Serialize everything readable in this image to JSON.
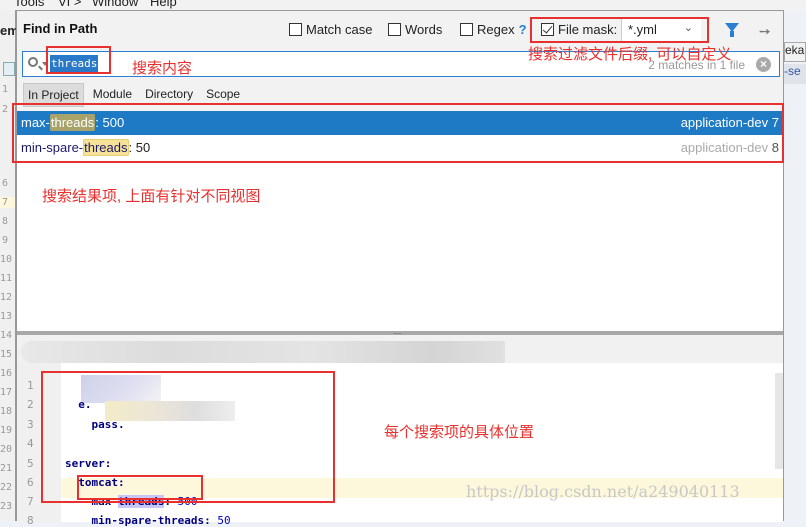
{
  "background": {
    "menu": [
      "Tools",
      "VI >",
      "Window",
      "Help"
    ],
    "left_truncated_label": "em",
    "right_tab_1": "eka",
    "right_tab_2": "-se",
    "gutter_lines": [
      "1",
      "2",
      "6",
      "7",
      "8",
      "9",
      "10",
      "11",
      "12",
      "13",
      "14",
      "15",
      "16",
      "17",
      "18",
      "19",
      "20",
      "21",
      "22",
      "23"
    ]
  },
  "dialog": {
    "title": "Find in Path",
    "options": {
      "match_case": {
        "label": "Match case",
        "checked": false
      },
      "words": {
        "label": "Words",
        "checked": false
      },
      "regex": {
        "label": "Regex",
        "checked": false,
        "help": "?"
      },
      "file_mask": {
        "label": "File mask:",
        "checked": true,
        "value": "*.yml"
      }
    },
    "search": {
      "value": "threads",
      "match_count": "2 matches in 1 file"
    },
    "scope_tabs": [
      {
        "label": "In Project",
        "active": true
      },
      {
        "label": "Module",
        "active": false
      },
      {
        "label": "Directory",
        "active": false
      },
      {
        "label": "Scope",
        "active": false
      }
    ],
    "results": [
      {
        "prefix": "max-",
        "match": "threads",
        "suffix": ": 500",
        "file": "application-dev",
        "line": "7",
        "selected": true
      },
      {
        "prefix": "min-spare-",
        "match": "threads",
        "suffix": ": 50",
        "file": "application-dev",
        "line": "8",
        "selected": false
      }
    ],
    "preview": {
      "lines": [
        {
          "num": "1",
          "text": ""
        },
        {
          "num": "2",
          "text": "  e."
        },
        {
          "num": "3",
          "text": "    pass."
        },
        {
          "num": "4",
          "text": ""
        },
        {
          "num": "5",
          "text": "server:"
        },
        {
          "num": "6",
          "text": "  tomcat:"
        },
        {
          "num": "7",
          "pre": "    max-",
          "match": "threads",
          "post": ": ",
          "value": "500"
        },
        {
          "num": "8",
          "pre": "    min-spare-threads: ",
          "value": "50"
        }
      ]
    }
  },
  "annotations": {
    "search_content": "搜索内容",
    "file_mask_note": "搜索过滤文件后缀, 可以自定义",
    "results_note": "搜索结果项, 上面有针对不同视图",
    "preview_note": "每个搜索项的具体位置"
  },
  "watermark": "https://blog.csdn.net/a249040113",
  "colors": {
    "accent": "#1e7ac4",
    "annotation_red": "#e8312f",
    "match_highlight": "#f7e29a"
  }
}
